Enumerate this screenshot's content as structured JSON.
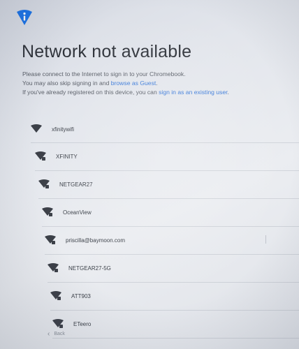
{
  "header": {
    "icon": "info-icon",
    "title": "Network not available"
  },
  "description": {
    "line1": "Please connect to the Internet to sign in to your Chromebook.",
    "line2_prefix": "You may also skip signing in and ",
    "line2_link": "browse as Guest",
    "line2_suffix": ".",
    "line3_prefix": "If you've already registered on this device, you can ",
    "line3_link": "sign in as an existing user",
    "line3_suffix": "."
  },
  "networks": [
    {
      "name": "xfinitywifi",
      "icon": "wifi-open-icon",
      "secured": false
    },
    {
      "name": "XFINITY",
      "icon": "wifi-secured-icon",
      "secured": true
    },
    {
      "name": "NETGEAR27",
      "icon": "wifi-secured-icon",
      "secured": true
    },
    {
      "name": "OceanView",
      "icon": "wifi-secured-icon",
      "secured": true
    },
    {
      "name": "priscilla@baymoon.com",
      "icon": "wifi-secured-icon",
      "secured": true
    },
    {
      "name": "NETGEAR27-5G",
      "icon": "wifi-secured-icon",
      "secured": true
    },
    {
      "name": "ATT903",
      "icon": "wifi-secured-icon",
      "secured": true
    },
    {
      "name": "ETeero",
      "icon": "wifi-secured-icon",
      "secured": true
    }
  ],
  "footer": {
    "back_label": "Back"
  },
  "colors": {
    "accent": "#3b7ad9",
    "icon_blue": "#1a73e8"
  }
}
